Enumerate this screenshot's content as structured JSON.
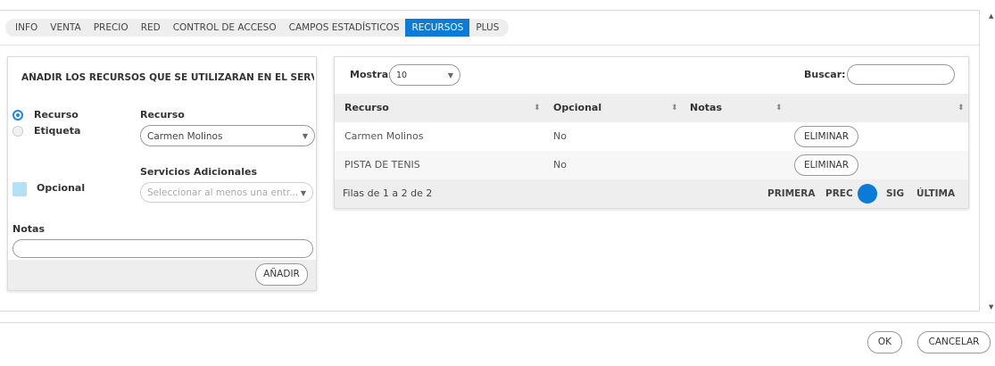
{
  "tabs": [
    "INFO",
    "VENTA",
    "PRECIO",
    "RED",
    "CONTROL DE ACCESO",
    "CAMPOS ESTADÍSTICOS",
    "RECURSOS",
    "PLUS"
  ],
  "active_tab": "RECURSOS",
  "add_panel": {
    "title": "AÑADIR LOS RECURSOS QUE SE UTILIZARÁN EN EL SERVICIO",
    "radio_resource": "Recurso",
    "radio_tag": "Etiqueta",
    "selected_radio": "Recurso",
    "resource_label": "Recurso",
    "resource_value": "Carmen Molinos",
    "optional_label": "Opcional",
    "extra_services_label": "Servicios Adicionales",
    "extra_services_placeholder": "Seleccionar al menos una entr...",
    "notes_label": "Notas",
    "notes_value": "",
    "add_button": "AÑADIR"
  },
  "table": {
    "show_label": "Mostrar",
    "page_size": "10",
    "search_label": "Buscar:",
    "search_value": "",
    "columns": [
      "Recurso",
      "Opcional",
      "Notas",
      ""
    ],
    "rows": [
      {
        "resource": "Carmen Molinos",
        "optional": "No",
        "notes": "",
        "action": "ELIMINAR"
      },
      {
        "resource": "PISTA DE TENIS",
        "optional": "No",
        "notes": "",
        "action": "ELIMINAR"
      }
    ],
    "info": "Filas de 1 a 2 de 2",
    "pager": {
      "first": "PRIMERA",
      "prev": "PREC",
      "current": "1",
      "next": "SIG",
      "last": "ÚLTIMA"
    }
  },
  "footer": {
    "ok": "OK",
    "cancel": "CANCELAR"
  },
  "colors": {
    "accent": "#0a7bd6",
    "checkbox": "#b3e1f5"
  }
}
